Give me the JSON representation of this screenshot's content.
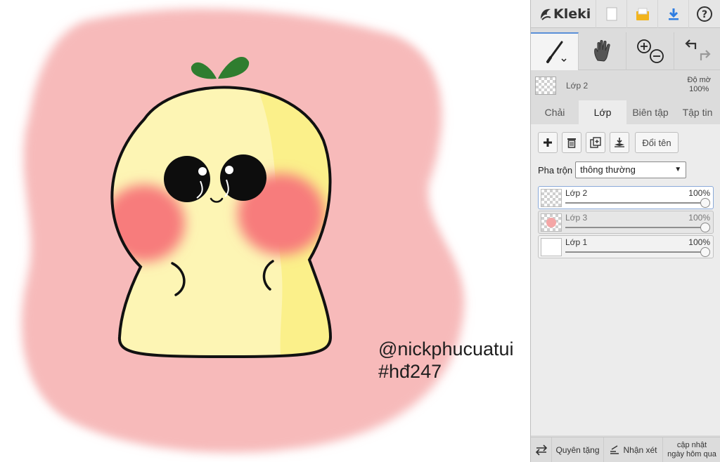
{
  "canvas": {
    "watermark_line1": "@nickphucuatui",
    "watermark_line2": "#hđ247"
  },
  "app": {
    "logo_text": "Kleki",
    "topbar_icons": [
      "new-image-icon",
      "save-icon",
      "download-icon",
      "help-icon"
    ],
    "help_glyph": "?"
  },
  "tools": {
    "items": [
      "brush-icon",
      "hand-icon",
      "zoom-icon",
      "undo-redo-icon"
    ],
    "active": "brush-icon"
  },
  "current_layer": {
    "name": "Lớp 2",
    "opacity_label": "Độ mờ",
    "opacity_value": "100%"
  },
  "tabs": [
    {
      "label": "Chải"
    },
    {
      "label": "Lớp"
    },
    {
      "label": "Biên tập"
    },
    {
      "label": "Tập tin"
    }
  ],
  "active_tab": "Lớp",
  "layer_actions": {
    "icons": [
      "add-layer-icon",
      "delete-layer-icon",
      "duplicate-layer-icon",
      "merge-down-icon"
    ],
    "rename_label": "Đổi tên"
  },
  "blend": {
    "label": "Pha trộn",
    "value": "thông thường"
  },
  "layers": [
    {
      "name": "Lớp 2",
      "opacity": "100%",
      "opacity_fraction": 1.0,
      "active": true
    },
    {
      "name": "Lớp 3",
      "opacity": "100%",
      "opacity_fraction": 1.0,
      "active": false
    },
    {
      "name": "Lớp 1",
      "opacity": "100%",
      "opacity_fraction": 1.0,
      "active": false
    }
  ],
  "footer": {
    "swap_icon": "swap-icon",
    "donate_label": "Quyên tặng",
    "feedback_label": "Nhận xét",
    "update_line1": "cập nhật",
    "update_line2": "ngày hôm qua"
  },
  "colors": {
    "body_yellow": "#fdf5b4",
    "body_shade": "#fbf08a",
    "blush": "#f77c7c",
    "background_blush": "#f7b7b7",
    "sprout": "#2f7d2f",
    "accent_blue": "#2f7de1",
    "save_orange": "#f2b41c"
  }
}
